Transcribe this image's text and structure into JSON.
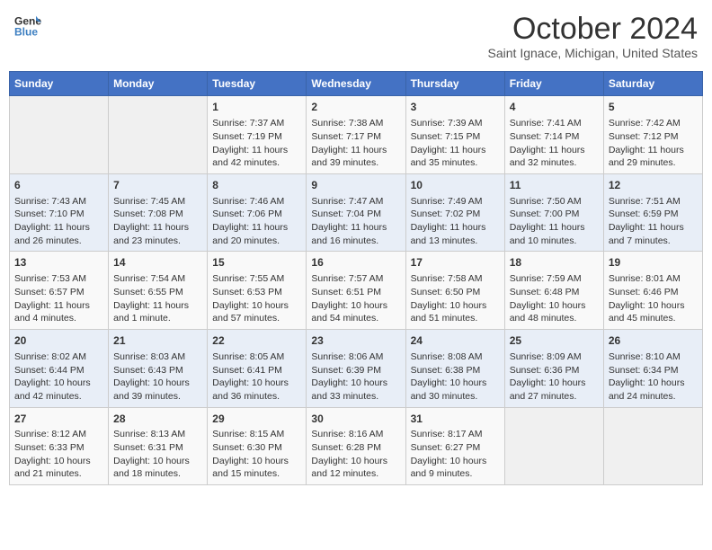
{
  "header": {
    "logo_line1": "General",
    "logo_line2": "Blue",
    "month_title": "October 2024",
    "subtitle": "Saint Ignace, Michigan, United States"
  },
  "days_of_week": [
    "Sunday",
    "Monday",
    "Tuesday",
    "Wednesday",
    "Thursday",
    "Friday",
    "Saturday"
  ],
  "weeks": [
    [
      {
        "day": "",
        "info": ""
      },
      {
        "day": "",
        "info": ""
      },
      {
        "day": "1",
        "info": "Sunrise: 7:37 AM\nSunset: 7:19 PM\nDaylight: 11 hours and 42 minutes."
      },
      {
        "day": "2",
        "info": "Sunrise: 7:38 AM\nSunset: 7:17 PM\nDaylight: 11 hours and 39 minutes."
      },
      {
        "day": "3",
        "info": "Sunrise: 7:39 AM\nSunset: 7:15 PM\nDaylight: 11 hours and 35 minutes."
      },
      {
        "day": "4",
        "info": "Sunrise: 7:41 AM\nSunset: 7:14 PM\nDaylight: 11 hours and 32 minutes."
      },
      {
        "day": "5",
        "info": "Sunrise: 7:42 AM\nSunset: 7:12 PM\nDaylight: 11 hours and 29 minutes."
      }
    ],
    [
      {
        "day": "6",
        "info": "Sunrise: 7:43 AM\nSunset: 7:10 PM\nDaylight: 11 hours and 26 minutes."
      },
      {
        "day": "7",
        "info": "Sunrise: 7:45 AM\nSunset: 7:08 PM\nDaylight: 11 hours and 23 minutes."
      },
      {
        "day": "8",
        "info": "Sunrise: 7:46 AM\nSunset: 7:06 PM\nDaylight: 11 hours and 20 minutes."
      },
      {
        "day": "9",
        "info": "Sunrise: 7:47 AM\nSunset: 7:04 PM\nDaylight: 11 hours and 16 minutes."
      },
      {
        "day": "10",
        "info": "Sunrise: 7:49 AM\nSunset: 7:02 PM\nDaylight: 11 hours and 13 minutes."
      },
      {
        "day": "11",
        "info": "Sunrise: 7:50 AM\nSunset: 7:00 PM\nDaylight: 11 hours and 10 minutes."
      },
      {
        "day": "12",
        "info": "Sunrise: 7:51 AM\nSunset: 6:59 PM\nDaylight: 11 hours and 7 minutes."
      }
    ],
    [
      {
        "day": "13",
        "info": "Sunrise: 7:53 AM\nSunset: 6:57 PM\nDaylight: 11 hours and 4 minutes."
      },
      {
        "day": "14",
        "info": "Sunrise: 7:54 AM\nSunset: 6:55 PM\nDaylight: 11 hours and 1 minute."
      },
      {
        "day": "15",
        "info": "Sunrise: 7:55 AM\nSunset: 6:53 PM\nDaylight: 10 hours and 57 minutes."
      },
      {
        "day": "16",
        "info": "Sunrise: 7:57 AM\nSunset: 6:51 PM\nDaylight: 10 hours and 54 minutes."
      },
      {
        "day": "17",
        "info": "Sunrise: 7:58 AM\nSunset: 6:50 PM\nDaylight: 10 hours and 51 minutes."
      },
      {
        "day": "18",
        "info": "Sunrise: 7:59 AM\nSunset: 6:48 PM\nDaylight: 10 hours and 48 minutes."
      },
      {
        "day": "19",
        "info": "Sunrise: 8:01 AM\nSunset: 6:46 PM\nDaylight: 10 hours and 45 minutes."
      }
    ],
    [
      {
        "day": "20",
        "info": "Sunrise: 8:02 AM\nSunset: 6:44 PM\nDaylight: 10 hours and 42 minutes."
      },
      {
        "day": "21",
        "info": "Sunrise: 8:03 AM\nSunset: 6:43 PM\nDaylight: 10 hours and 39 minutes."
      },
      {
        "day": "22",
        "info": "Sunrise: 8:05 AM\nSunset: 6:41 PM\nDaylight: 10 hours and 36 minutes."
      },
      {
        "day": "23",
        "info": "Sunrise: 8:06 AM\nSunset: 6:39 PM\nDaylight: 10 hours and 33 minutes."
      },
      {
        "day": "24",
        "info": "Sunrise: 8:08 AM\nSunset: 6:38 PM\nDaylight: 10 hours and 30 minutes."
      },
      {
        "day": "25",
        "info": "Sunrise: 8:09 AM\nSunset: 6:36 PM\nDaylight: 10 hours and 27 minutes."
      },
      {
        "day": "26",
        "info": "Sunrise: 8:10 AM\nSunset: 6:34 PM\nDaylight: 10 hours and 24 minutes."
      }
    ],
    [
      {
        "day": "27",
        "info": "Sunrise: 8:12 AM\nSunset: 6:33 PM\nDaylight: 10 hours and 21 minutes."
      },
      {
        "day": "28",
        "info": "Sunrise: 8:13 AM\nSunset: 6:31 PM\nDaylight: 10 hours and 18 minutes."
      },
      {
        "day": "29",
        "info": "Sunrise: 8:15 AM\nSunset: 6:30 PM\nDaylight: 10 hours and 15 minutes."
      },
      {
        "day": "30",
        "info": "Sunrise: 8:16 AM\nSunset: 6:28 PM\nDaylight: 10 hours and 12 minutes."
      },
      {
        "day": "31",
        "info": "Sunrise: 8:17 AM\nSunset: 6:27 PM\nDaylight: 10 hours and 9 minutes."
      },
      {
        "day": "",
        "info": ""
      },
      {
        "day": "",
        "info": ""
      }
    ]
  ]
}
